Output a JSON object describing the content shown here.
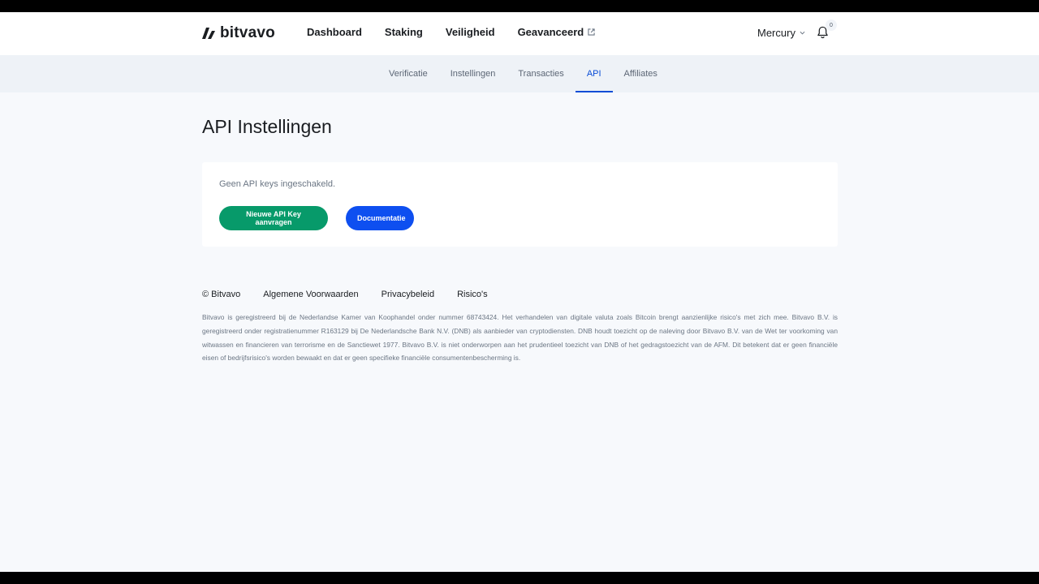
{
  "brand": {
    "name": "bitvavo"
  },
  "nav": {
    "items": [
      {
        "label": "Dashboard"
      },
      {
        "label": "Staking"
      },
      {
        "label": "Veiligheid"
      },
      {
        "label": "Geavanceerd"
      }
    ]
  },
  "user": {
    "name": "Mercury",
    "notification_count": "0"
  },
  "subnav": {
    "tabs": [
      {
        "label": "Verificatie"
      },
      {
        "label": "Instellingen"
      },
      {
        "label": "Transacties"
      },
      {
        "label": "API"
      },
      {
        "label": "Affiliates"
      }
    ],
    "active": "API"
  },
  "main": {
    "title": "API Instellingen",
    "empty_message": "Geen API keys ingeschakeld.",
    "new_key_button": "Nieuwe API Key aanvragen",
    "docs_button": "Documentatie"
  },
  "footer": {
    "copyright": "© Bitvavo",
    "links": [
      "Algemene Voorwaarden",
      "Privacybeleid",
      "Risico's"
    ],
    "disclaimer": "Bitvavo is geregistreerd bij de Nederlandse Kamer van Koophandel onder nummer 68743424. Het verhandelen van digitale valuta zoals Bitcoin brengt aanzienlijke risico's met zich mee. Bitvavo B.V. is geregistreerd onder registratienummer R163129 bij De Nederlandsche Bank N.V. (DNB) als aanbieder van cryptodiensten. DNB houdt toezicht op de naleving door Bitvavo B.V. van de Wet ter voorkoming van witwassen en financieren van terrorisme en de Sanctiewet 1977. Bitvavo B.V. is niet onderworpen aan het prudentieel toezicht van DNB of het gedragstoezicht van de AFM. Dit betekent dat er geen financiële eisen of bedrijfsrisico's worden bewaakt en dat er geen specifieke financiële consumentenbescherming is."
  },
  "colors": {
    "accent": "#0a4dd6",
    "green_button": "#079a6a",
    "blue_button": "#0e4ff0",
    "page_bg": "#f7f9fc"
  }
}
